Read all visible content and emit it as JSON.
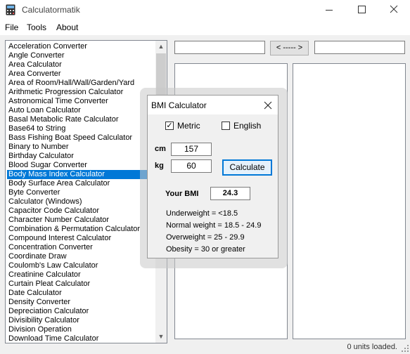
{
  "window": {
    "title": "Calculatormatik"
  },
  "menu": {
    "file": "File",
    "tools": "Tools",
    "about": "About"
  },
  "converter_list": [
    "Acceleration Converter",
    "Angle Converter",
    "Area Calculator",
    "Area Converter",
    "Area of Room/Hall/Wall/Garden/Yard",
    "Arithmetic Progression Calculator",
    "Astronomical Time Converter",
    "Auto Loan Calculator",
    "Basal Metabolic Rate Calculator",
    "Base64 to String",
    "Bass Fishing Boat Speed Calculator",
    "Binary to Number",
    "Birthday Calculator",
    "Blood Sugar Converter",
    "Body Mass Index Calculator",
    "Body Surface Area Calculator",
    "Byte Converter",
    "Calculator (Windows)",
    "Capacitor Code Calculator",
    "Character Number Calculator",
    "Combination & Permutation Calculator",
    "Compound Interest Calculator",
    "Concentration Converter",
    "Coordinate Draw",
    "Coulomb's Law Calculator",
    "Creatinine Calculator",
    "Curtain Pleat Calculator",
    "Date Calculator",
    "Density Converter",
    "Depreciation Calculator",
    "Divisibility Calculator",
    "Division Operation",
    "Download Time Calculator"
  ],
  "selected_index": 14,
  "swap_button": "< ----- >",
  "status": "0 units loaded.",
  "dialog": {
    "title": "BMI Calculator",
    "metric_label": "Metric",
    "metric_checked": "✓",
    "english_label": "English",
    "cm_label": "cm",
    "cm_value": "157",
    "kg_label": "kg",
    "kg_value": "60",
    "calculate_label": "Calculate",
    "your_bmi_label": "Your BMI",
    "bmi_value": "24.3",
    "ranges": [
      "Underweight = <18.5",
      "Normal weight = 18.5 - 24.9",
      "Overweight = 25 - 29.9",
      "Obesity = 30 or greater"
    ]
  }
}
